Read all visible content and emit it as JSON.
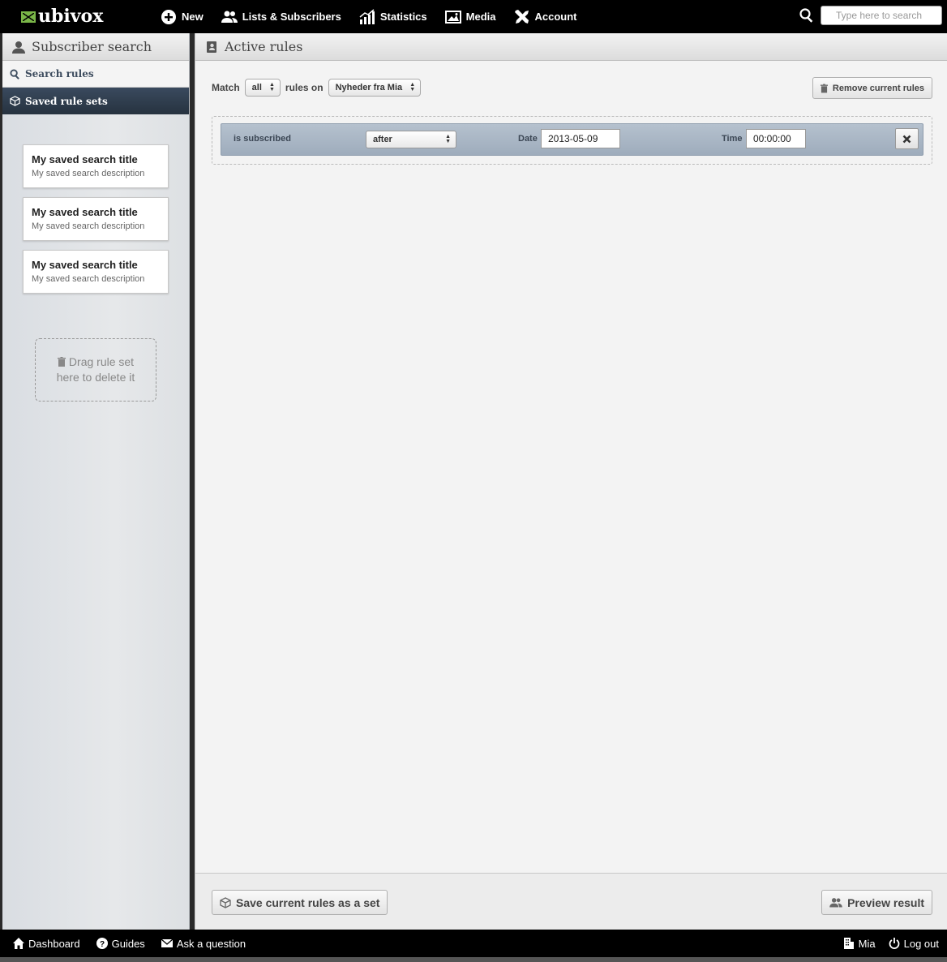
{
  "brand": {
    "name": "ubivox"
  },
  "nav": {
    "new": "New",
    "lists": "Lists & Subscribers",
    "statistics": "Statistics",
    "media": "Media",
    "account": "Account"
  },
  "search": {
    "placeholder": "Type here to search"
  },
  "sidebar": {
    "title": "Subscriber search",
    "tab_search": "Search rules",
    "tab_saved": "Saved rule sets",
    "saved_sets": [
      {
        "title": "My saved search title",
        "description": "My saved search description"
      },
      {
        "title": "My saved search title",
        "description": "My saved search description"
      },
      {
        "title": "My saved search title",
        "description": "My saved search description"
      }
    ],
    "dropzone": "Drag rule set here to delete it"
  },
  "main": {
    "title": "Active rules",
    "match_label": "Match",
    "match_value": "all",
    "rules_on_label": "rules on",
    "list_value": "Nyheder fra Mia",
    "remove_button": "Remove current rules",
    "rule": {
      "field": "is subscribed",
      "operator": "after",
      "date_label": "Date",
      "date_value": "2013-05-09",
      "time_label": "Time",
      "time_value": "00:00:00"
    },
    "save_button": "Save current rules as a set",
    "preview_button": "Preview result"
  },
  "footer": {
    "dashboard": "Dashboard",
    "guides": "Guides",
    "ask": "Ask a question",
    "user": "Mia",
    "logout": "Log out"
  }
}
